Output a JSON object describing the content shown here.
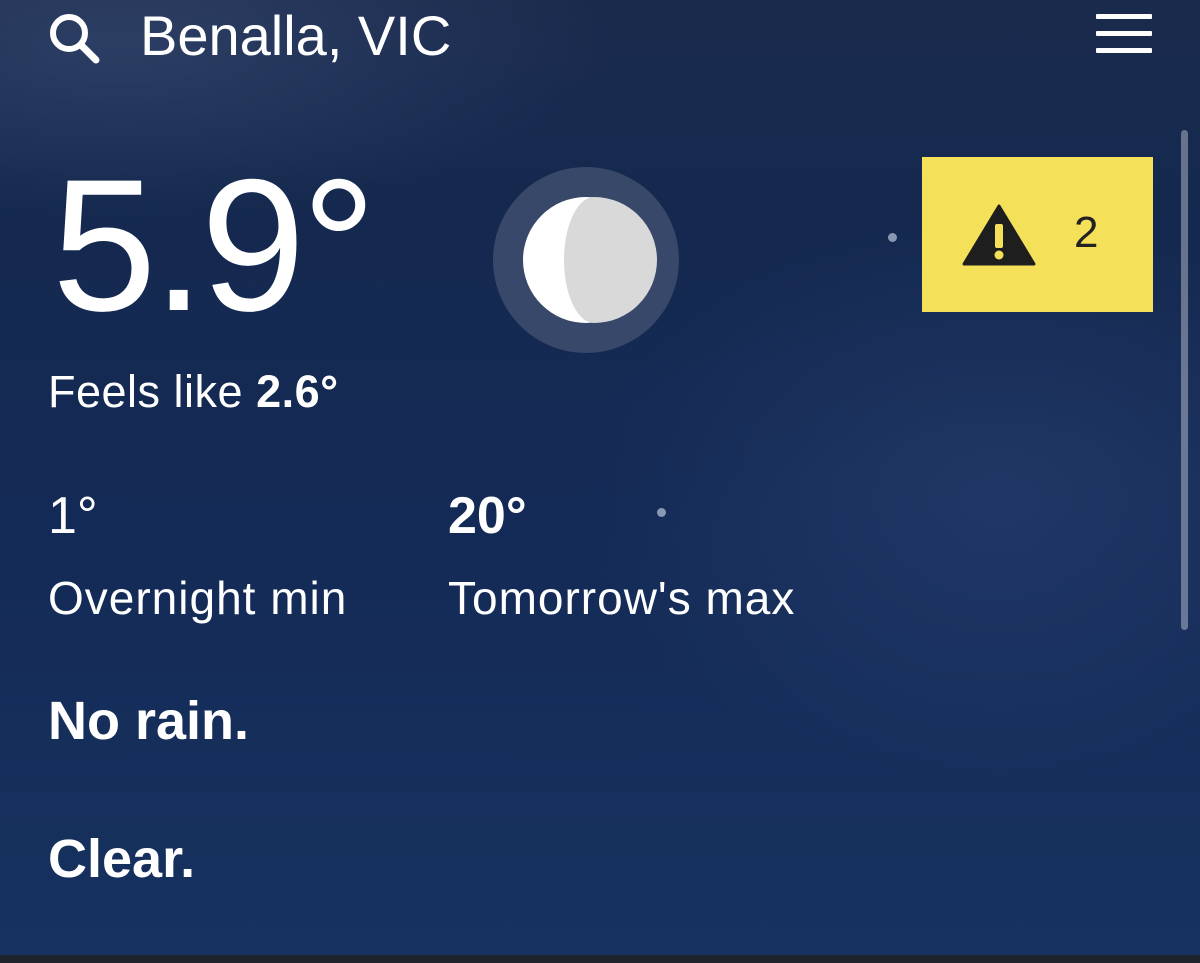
{
  "header": {
    "location": "Benalla, VIC"
  },
  "current": {
    "temperature": "5.9°",
    "feels_like_label": "Feels like",
    "feels_like_value": "2.6°",
    "condition_icon": "moon-icon"
  },
  "warnings": {
    "count": "2",
    "icon": "warning-icon",
    "color": "#f5e05a"
  },
  "forecast": {
    "overnight_min": "1°",
    "overnight_min_label": "Overnight min",
    "tomorrow_max": "20°",
    "tomorrow_max_label": "Tomorrow's max"
  },
  "summary": {
    "rain": "No rain.",
    "condition": "Clear."
  },
  "colors": {
    "background": "#15294f",
    "text": "#ffffff",
    "warning": "#f5e05a"
  }
}
